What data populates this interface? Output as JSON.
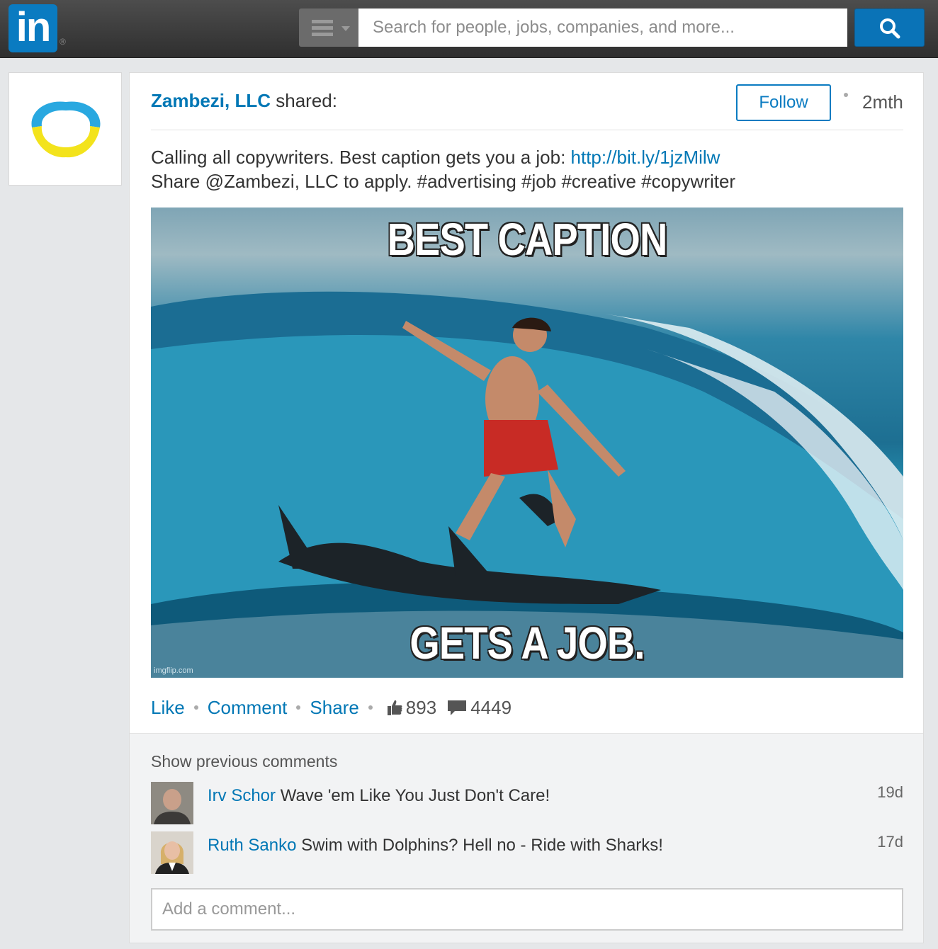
{
  "topbar": {
    "logo_text": "in",
    "registered_mark": "®",
    "search_placeholder": "Search for people, jobs, companies, and more..."
  },
  "post": {
    "company": "Zambezi, LLC",
    "shared_label": "shared:",
    "follow_label": "Follow",
    "time": "2mth",
    "text_line1": "Calling all copywriters. Best caption gets you a job: ",
    "link": "http://bit.ly/1jzMilw",
    "text_line2": "Share @Zambezi, LLC to apply. #advertising #job #creative #copywriter",
    "image": {
      "caption_top": "BEST CAPTION",
      "caption_bottom": "GETS A JOB.",
      "watermark": "imgflip.com"
    },
    "actions": {
      "like": "Like",
      "comment": "Comment",
      "share": "Share",
      "like_count": "893",
      "comment_count": "4449"
    }
  },
  "comments": {
    "show_previous": "Show previous comments",
    "items": [
      {
        "author": "Irv Schor",
        "text": "Wave 'em Like You Just Don't Care!",
        "time": "19d"
      },
      {
        "author": "Ruth Sanko",
        "text": "Swim with Dolphins? Hell no - Ride with Sharks!",
        "time": "17d"
      }
    ],
    "add_placeholder": "Add a comment..."
  },
  "colors": {
    "brand_blue": "#0077b5",
    "topbar": "#3a3a3a",
    "background": "#e5e7e9"
  },
  "icons": [
    "menu-icon",
    "search-icon",
    "company-logo-icon",
    "thumbs-up-icon",
    "comment-bubble-icon"
  ]
}
